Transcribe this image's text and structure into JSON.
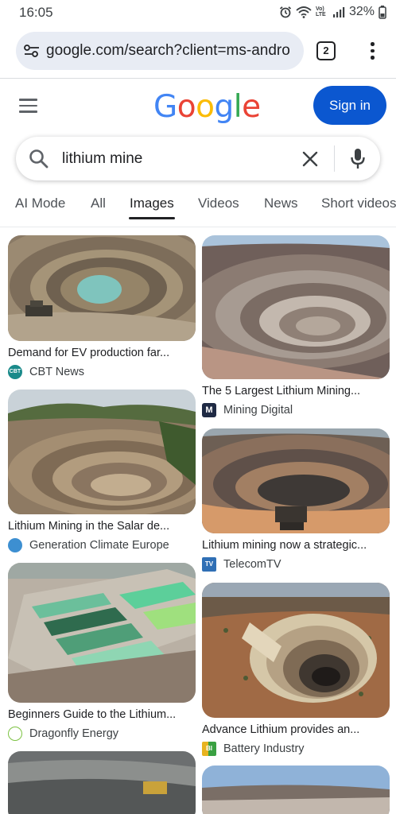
{
  "status_bar": {
    "time": "16:05",
    "network_label": "Vo) LTE",
    "battery": "32%"
  },
  "browser": {
    "url": "google.com/search?client=ms-andro",
    "tab_count": "2"
  },
  "header": {
    "logo": "Google",
    "logo_colors": [
      "#4285F4",
      "#EA4335",
      "#FBBC05",
      "#4285F4",
      "#34A853",
      "#EA4335"
    ],
    "sign_in_label": "Sign in"
  },
  "search": {
    "query": "lithium mine"
  },
  "filter_tabs": [
    {
      "label": "AI Mode",
      "active": false
    },
    {
      "label": "All",
      "active": false
    },
    {
      "label": "Images",
      "active": true
    },
    {
      "label": "Videos",
      "active": false
    },
    {
      "label": "News",
      "active": false
    },
    {
      "label": "Short videos",
      "active": false
    }
  ],
  "results": [
    {
      "title": "Demand for EV production far...",
      "source": "CBT News",
      "favicon": "CBT",
      "favicon_color": "#1a8a8a"
    },
    {
      "title": "The 5 Largest Lithium Mining...",
      "source": "Mining Digital",
      "favicon": "M",
      "favicon_color": "#1f2a44"
    },
    {
      "title": "Lithium Mining in the Salar de...",
      "source": "Generation Climate Europe",
      "favicon": "globe",
      "favicon_color": "#3d8fd1"
    },
    {
      "title": "Lithium mining now a strategic...",
      "source": "TelecomTV",
      "favicon": "TV",
      "favicon_color": "#2f6fb5"
    },
    {
      "title": "Beginners Guide to the Lithium...",
      "source": "Dragonfly Energy",
      "favicon": "dragonfly",
      "favicon_color": "#7cc242"
    },
    {
      "title": "Advance Lithium provides an...",
      "source": "Battery Industry",
      "favicon": "BI",
      "favicon_color": "#3aa142"
    }
  ]
}
